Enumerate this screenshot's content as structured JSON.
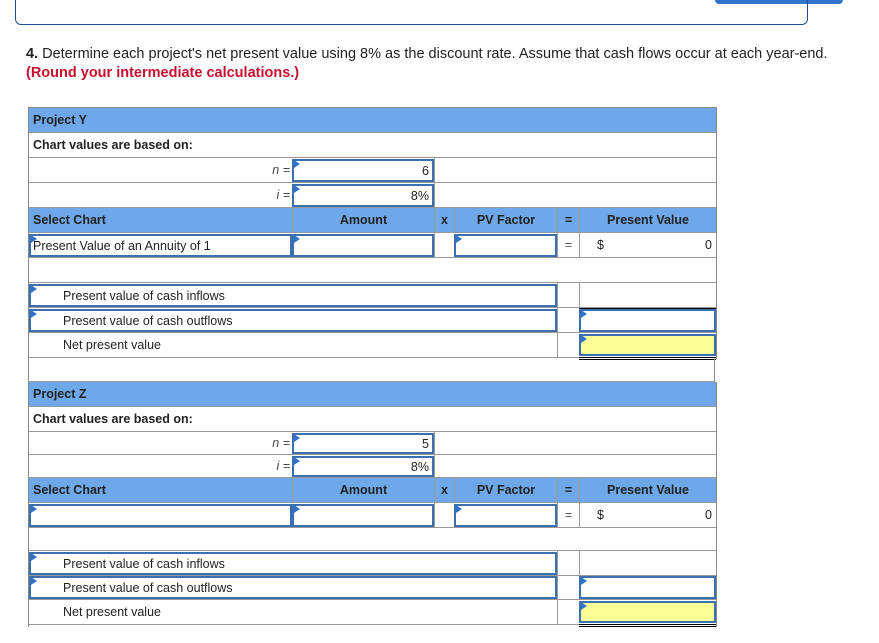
{
  "question": {
    "number": "4.",
    "text": " Determine each project's net present value using 8% as the discount rate. Assume that cash flows occur at each year-end. ",
    "note": "(Round your intermediate calculations.)"
  },
  "projects": [
    {
      "title": "Project Y",
      "chart_values_label": "Chart values are based on:",
      "n_label": "n =",
      "n_value": "6",
      "i_label": "i =",
      "i_value": "8%",
      "headers": {
        "select_chart": "Select Chart",
        "amount": "Amount",
        "times": "x",
        "pv_factor": "PV Factor",
        "equals": "=",
        "present_value": "Present Value"
      },
      "row": {
        "select_chart_value": "Present Value of an Annuity of 1",
        "amount_value": "",
        "pv_factor_value": "",
        "equals": "=",
        "currency": "$",
        "present_value": "0"
      },
      "summary": {
        "inflows_label": "Present value of cash inflows",
        "outflows_label": "Present value of cash outflows",
        "npv_label": "Net present value",
        "outflows_value": "",
        "npv_value": ""
      }
    },
    {
      "title": "Project Z",
      "chart_values_label": "Chart values are based on:",
      "n_label": "n =",
      "n_value": "5",
      "i_label": "i =",
      "i_value": "8%",
      "headers": {
        "select_chart": "Select Chart",
        "amount": "Amount",
        "times": "x",
        "pv_factor": "PV Factor",
        "equals": "=",
        "present_value": "Present Value"
      },
      "row": {
        "select_chart_value": "",
        "amount_value": "",
        "pv_factor_value": "",
        "equals": "=",
        "currency": "$",
        "present_value": "0"
      },
      "summary": {
        "inflows_label": "Present value of cash inflows",
        "outflows_label": "Present value of cash outflows",
        "npv_label": "Net present value",
        "outflows_value": "",
        "npv_value": ""
      }
    }
  ],
  "colors": {
    "header_blue": "#6fa8e8",
    "input_border": "#3b6fb0",
    "highlight_yellow": "#ffff99",
    "note_red": "#c8102e"
  }
}
